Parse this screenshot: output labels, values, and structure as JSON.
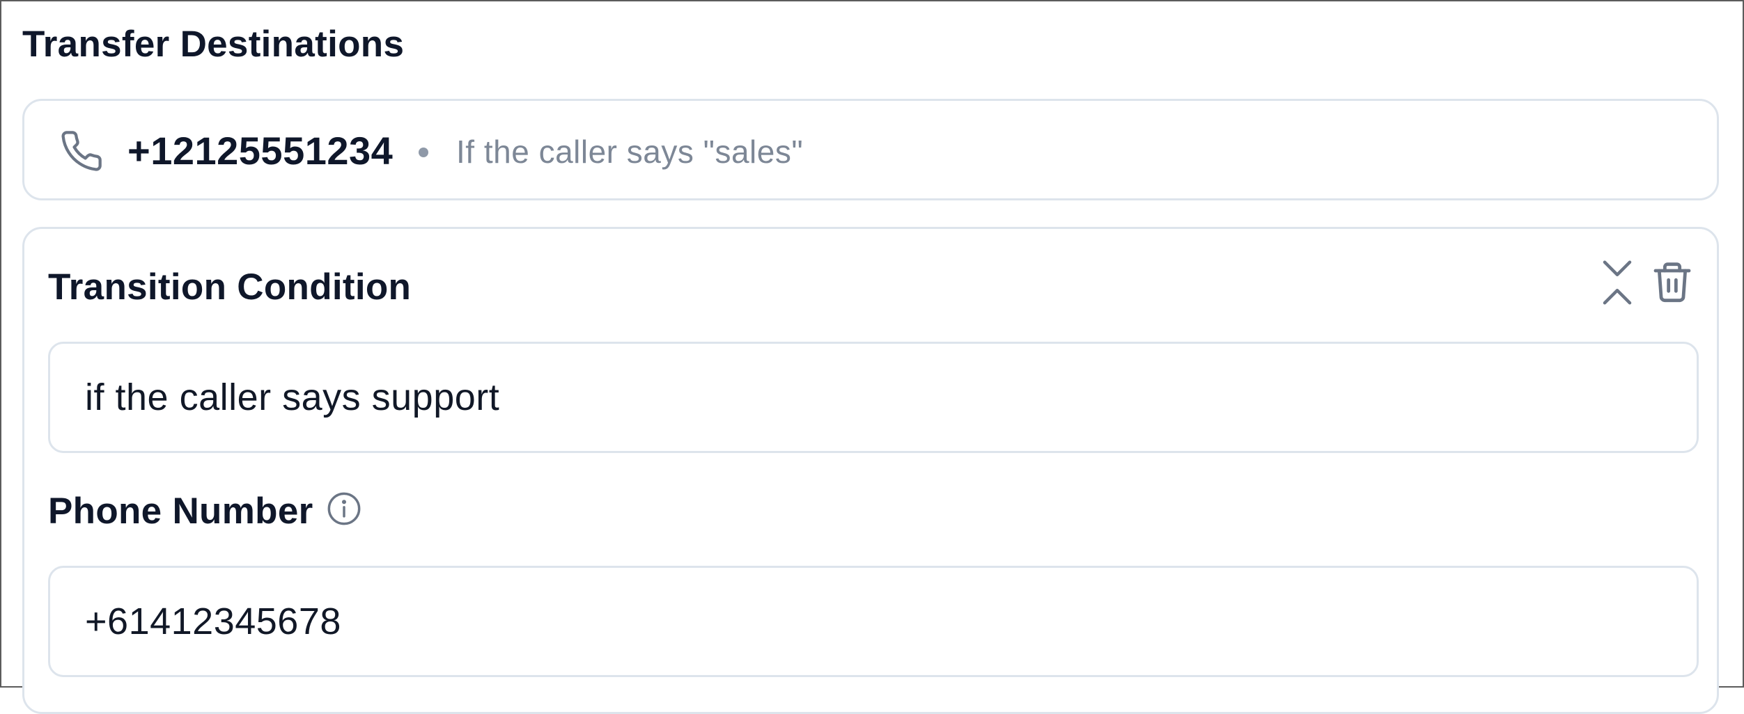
{
  "section": {
    "title": "Transfer Destinations"
  },
  "destinations": [
    {
      "number": "+12125551234",
      "condition": "If the caller says \"sales\"",
      "icon": "phone-icon"
    }
  ],
  "editor": {
    "condition_label": "Transition Condition",
    "condition_value": "if the caller says support",
    "phone_label": "Phone Number",
    "phone_value": "+61412345678",
    "actions": {
      "collapse_icon": "collapse-icon",
      "delete_icon": "trash-icon"
    },
    "info_icon": "info-icon"
  },
  "colors": {
    "border": "#dde4ec",
    "muted_text": "#7d8796",
    "icon": "#6b7585",
    "text": "#0f172a"
  }
}
